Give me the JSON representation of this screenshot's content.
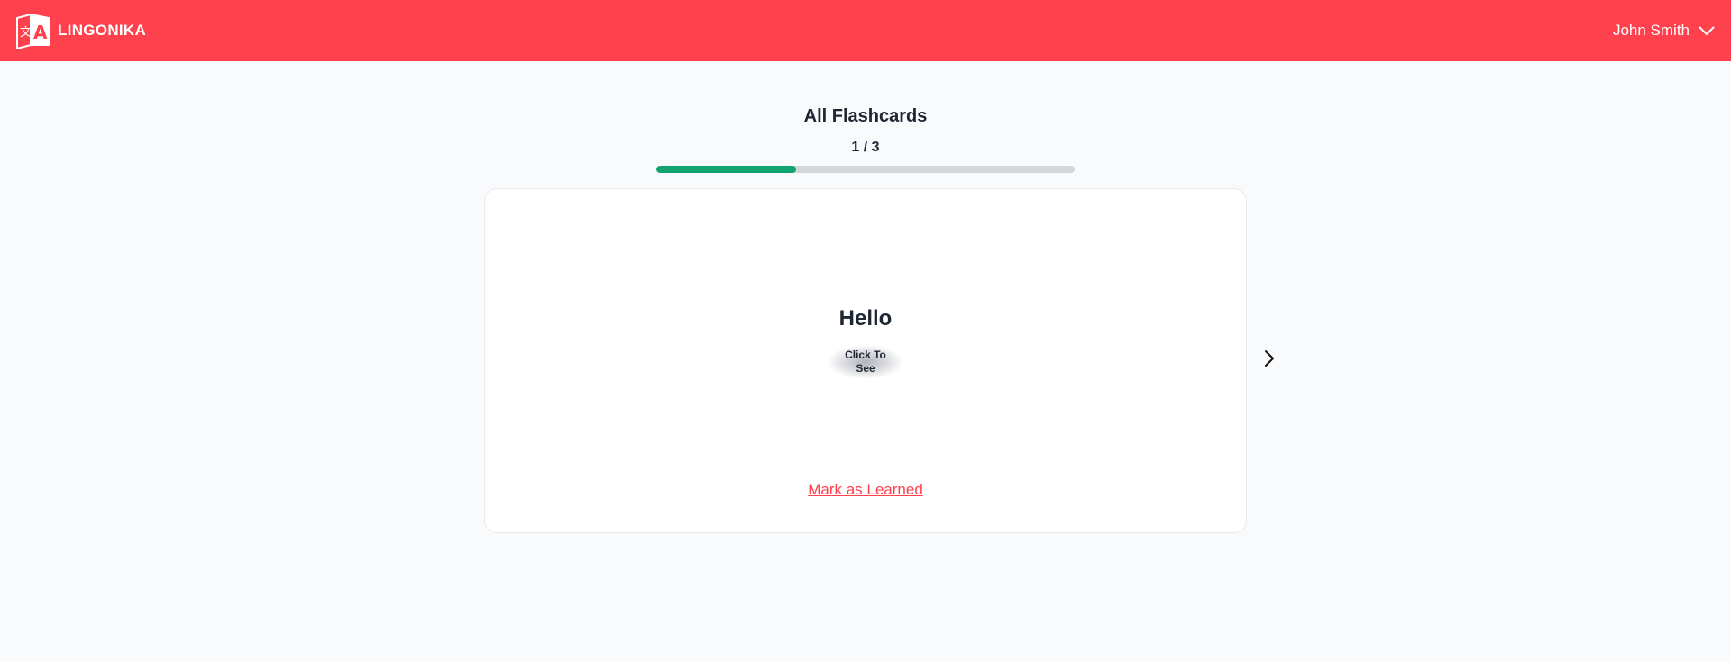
{
  "header": {
    "brand_name": "LINGONIKA",
    "logo_icon": "translate-book-icon",
    "user_name": "John Smith",
    "user_menu_icon": "chevron-down-icon",
    "accent_color": "#ff404d"
  },
  "flashcards": {
    "title": "All Flashcards",
    "counter": "1 / 3",
    "current": 1,
    "total": 3,
    "progress_fraction": 0.333,
    "progress_color": "#12a46f",
    "card": {
      "word": "Hello",
      "reveal_label": "Click To See",
      "mark_learned_label": "Mark as Learned"
    },
    "next_icon": "chevron-right-icon"
  }
}
